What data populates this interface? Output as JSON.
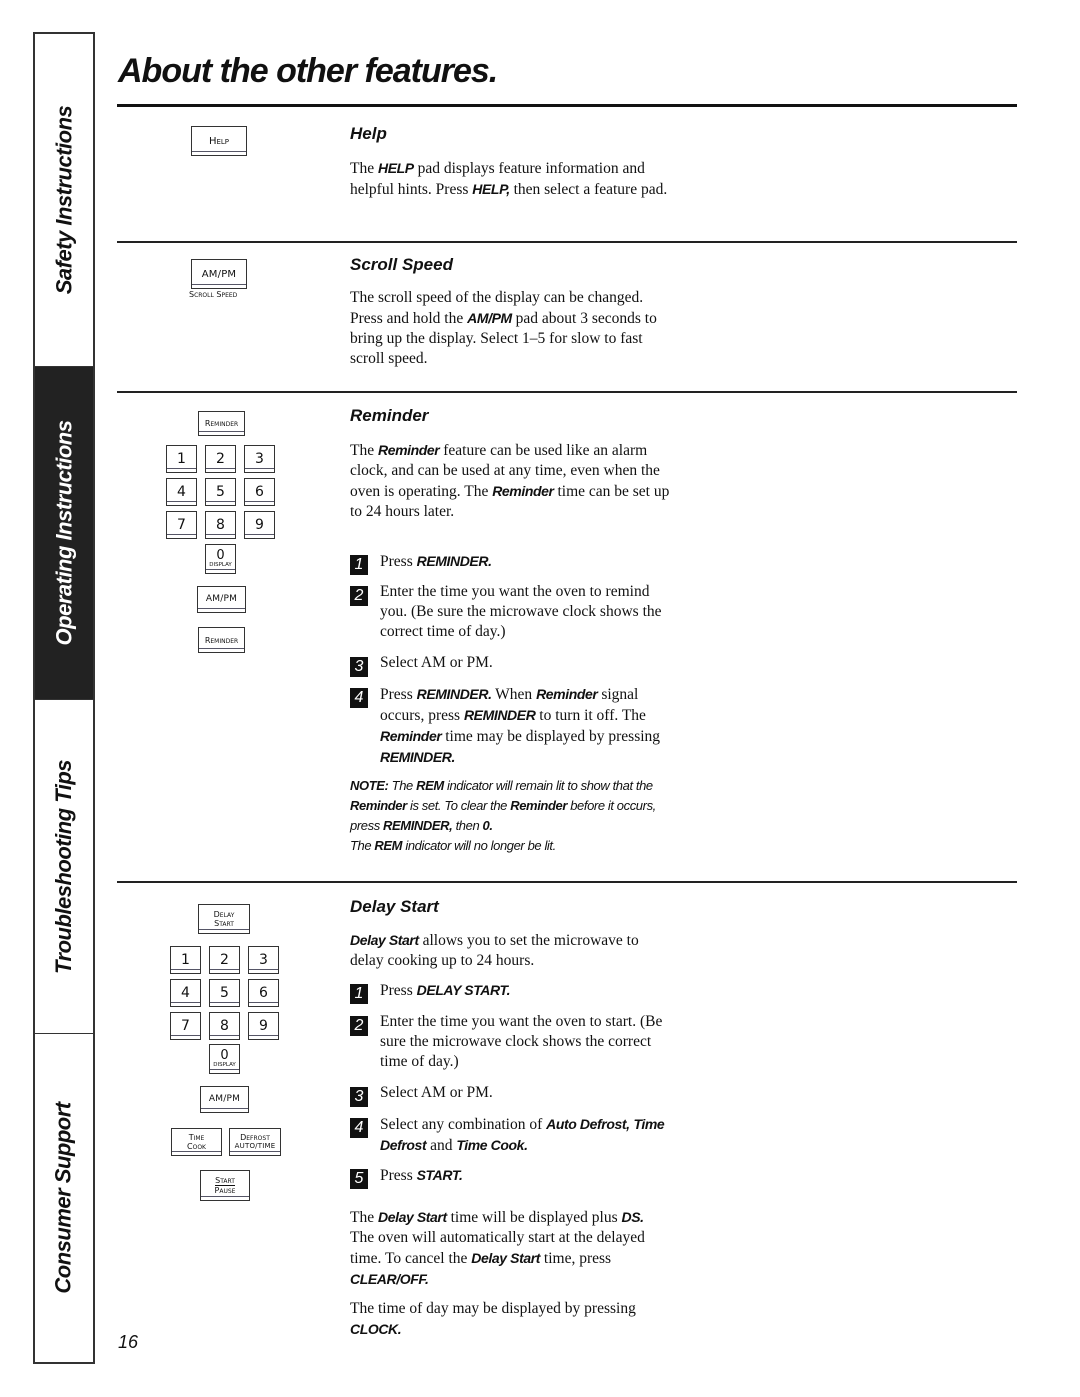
{
  "sidebar": {
    "tabs": [
      {
        "label": "Safety Instructions",
        "active": false
      },
      {
        "label": "Operating Instructions",
        "active": true
      },
      {
        "label": "Troubleshooting Tips",
        "active": false
      },
      {
        "label": "Consumer Support",
        "active": false
      }
    ]
  },
  "page": {
    "title": "About the other features.",
    "number": "16"
  },
  "help": {
    "key_label": "Help",
    "title": "Help",
    "body": [
      {
        "t": "The "
      },
      {
        "b": "HELP"
      },
      {
        "t": " pad displays feature information and helpful hints. Press "
      },
      {
        "b": "HELP,"
      },
      {
        "t": " then select a feature pad."
      }
    ]
  },
  "scroll_speed": {
    "key_label": "AM/PM",
    "key_sublabel": "Scroll Speed",
    "title": "Scroll Speed",
    "body": [
      {
        "t": "The scroll speed of the display can be changed. Press and hold the "
      },
      {
        "b": "AM/PM"
      },
      {
        "t": " pad about 3 seconds to bring up the display. Select 1–5 for slow to fast scroll speed."
      }
    ]
  },
  "reminder": {
    "keys": {
      "reminder": "Reminder",
      "digits": [
        "1",
        "2",
        "3",
        "4",
        "5",
        "6",
        "7",
        "8",
        "9"
      ],
      "zero": "0",
      "zero_sub": "DISPLAY",
      "ampm": "AM/PM"
    },
    "title": "Reminder",
    "intro": [
      {
        "t": "The "
      },
      {
        "b": "Reminder"
      },
      {
        "t": " feature can be used like an alarm clock, and can be used at any time, even when the oven is operating. The "
      },
      {
        "b": "Reminder"
      },
      {
        "t": " time can be set up to 24 hours later."
      }
    ],
    "steps": [
      {
        "num": "1",
        "text": [
          {
            "t": "Press "
          },
          {
            "b": "REMINDER."
          }
        ]
      },
      {
        "num": "2",
        "text": [
          {
            "t": "Enter the time you want the oven to remind you. (Be sure the microwave clock shows the correct time of day.)"
          }
        ]
      },
      {
        "num": "3",
        "text": [
          {
            "t": "Select AM or PM."
          }
        ]
      },
      {
        "num": "4",
        "text": [
          {
            "t": "Press "
          },
          {
            "b": "REMINDER."
          },
          {
            "t": " When "
          },
          {
            "b": "Reminder"
          },
          {
            "t": " signal occurs, press "
          },
          {
            "b": "REMINDER"
          },
          {
            "t": " to turn it off. The "
          },
          {
            "b": "Reminder"
          },
          {
            "t": " time may be displayed by pressing "
          },
          {
            "b": "REMINDER."
          }
        ]
      }
    ],
    "note": [
      {
        "b": "NOTE:"
      },
      {
        "t": " The "
      },
      {
        "b": "REM"
      },
      {
        "t": " indicator will remain lit to show that the "
      },
      {
        "b": "Reminder"
      },
      {
        "t": " is set. To clear the "
      },
      {
        "b": "Reminder"
      },
      {
        "t": " before it occurs, press "
      },
      {
        "b": "REMINDER,"
      },
      {
        "t": " then "
      },
      {
        "b": "0."
      },
      {
        "br": true
      },
      {
        "t": "The "
      },
      {
        "b": "REM"
      },
      {
        "t": " indicator will no longer be lit."
      }
    ]
  },
  "delay_start": {
    "keys": {
      "delay_start_line1": "Delay",
      "delay_start_line2": "Start",
      "digits": [
        "1",
        "2",
        "3",
        "4",
        "5",
        "6",
        "7",
        "8",
        "9"
      ],
      "zero": "0",
      "zero_sub": "DISPLAY",
      "ampm": "AM/PM",
      "time_cook_line1": "Time",
      "time_cook_line2": "Cook",
      "defrost_line1": "Defrost",
      "defrost_line2": "AUTO/TIME",
      "start_line1": "Start",
      "start_line2": "Pause"
    },
    "title": "Delay Start",
    "intro": [
      {
        "b": "Delay Start"
      },
      {
        "t": " allows you to set the microwave to delay cooking up to 24 hours."
      }
    ],
    "steps": [
      {
        "num": "1",
        "text": [
          {
            "t": "Press "
          },
          {
            "b": "DELAY START."
          }
        ]
      },
      {
        "num": "2",
        "text": [
          {
            "t": "Enter the time you want the oven to start. (Be sure the microwave clock shows the correct time of day.)"
          }
        ]
      },
      {
        "num": "3",
        "text": [
          {
            "t": "Select AM or PM."
          }
        ]
      },
      {
        "num": "4",
        "text": [
          {
            "t": "Select any combination of "
          },
          {
            "b": "Auto Defrost,"
          },
          {
            "t": " "
          },
          {
            "b": "Time Defrost"
          },
          {
            "t": " and "
          },
          {
            "b": "Time Cook."
          }
        ]
      },
      {
        "num": "5",
        "text": [
          {
            "t": "Press "
          },
          {
            "b": "START."
          }
        ]
      }
    ],
    "outro1": [
      {
        "t": "The "
      },
      {
        "b": "Delay Start"
      },
      {
        "t": " time will be displayed plus "
      },
      {
        "b": "DS."
      },
      {
        "t": " The oven will automatically start at the delayed time. To cancel the "
      },
      {
        "b": "Delay Start"
      },
      {
        "t": " time, press "
      },
      {
        "b": "CLEAR/OFF."
      }
    ],
    "outro2": [
      {
        "t": "The time of day may be displayed by pressing "
      },
      {
        "b": "CLOCK."
      }
    ]
  }
}
